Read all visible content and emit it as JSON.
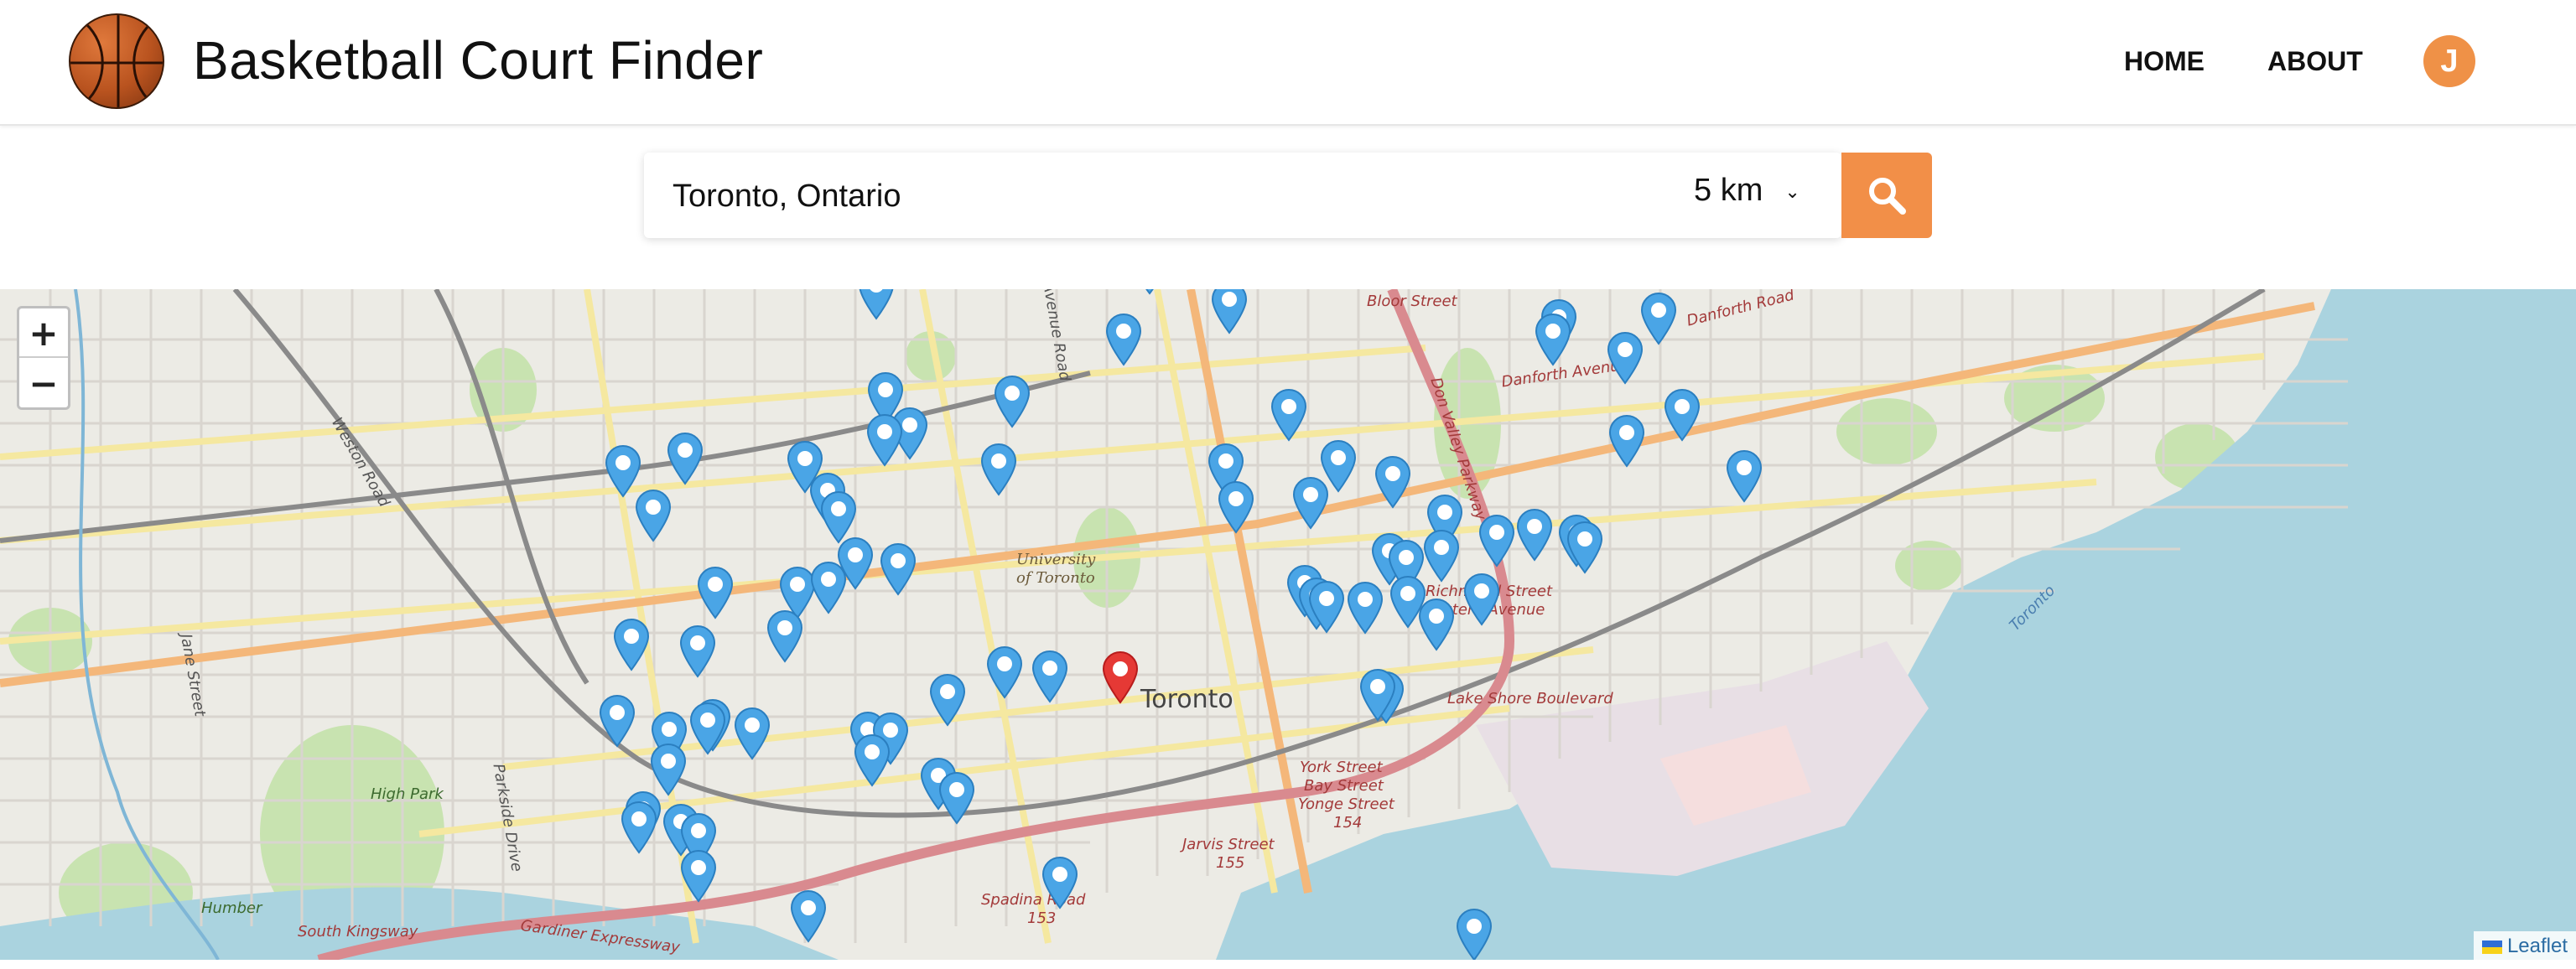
{
  "header": {
    "title": "Basketball Court Finder",
    "nav": [
      {
        "label": "HOME"
      },
      {
        "label": "ABOUT"
      }
    ],
    "avatar_initial": "J",
    "logo_icon": "basketball-icon"
  },
  "search": {
    "location_value": "Toronto, Ontario",
    "radius_value": "5 km",
    "search_icon": "search-icon"
  },
  "map": {
    "zoom_in_label": "+",
    "zoom_out_label": "−",
    "attribution": "Leaflet",
    "city_label": "Toronto",
    "university_label_line1": "University",
    "university_label_line2": "of Toronto",
    "street_labels": {
      "bloor": "Bloor Street",
      "danforth": "Danforth Avenue",
      "danforth_road": "Danforth Road",
      "lake_shore": "Lake Shore Boulevard",
      "richmond": "Richmond Street",
      "eastern": "Eastern Avenue",
      "york": "York Street",
      "bay": "Bay Street",
      "yonge": "Yonge Street",
      "yonge_num": "154",
      "jarvis": "Jarvis Street",
      "jarvis_num": "155",
      "spadina": "Spadina Road",
      "spadina_num": "153",
      "south_kingsway": "South Kingsway",
      "gardiner": "Gardiner Expressway",
      "high_park": "High Park",
      "humber": "Humber",
      "weston": "Weston Road",
      "jane": "Jane Street",
      "parkside": "Parkside Drive",
      "avenue_road": "Avenue Road",
      "don_valley": "Don Valley Parkway"
    },
    "water_label": "Toronto",
    "colors": {
      "water": "#aad3df",
      "land": "#ecebe5",
      "marker_blue": "#4aa5e6",
      "marker_red": "#e53935",
      "accent": "#f28f48"
    }
  }
}
